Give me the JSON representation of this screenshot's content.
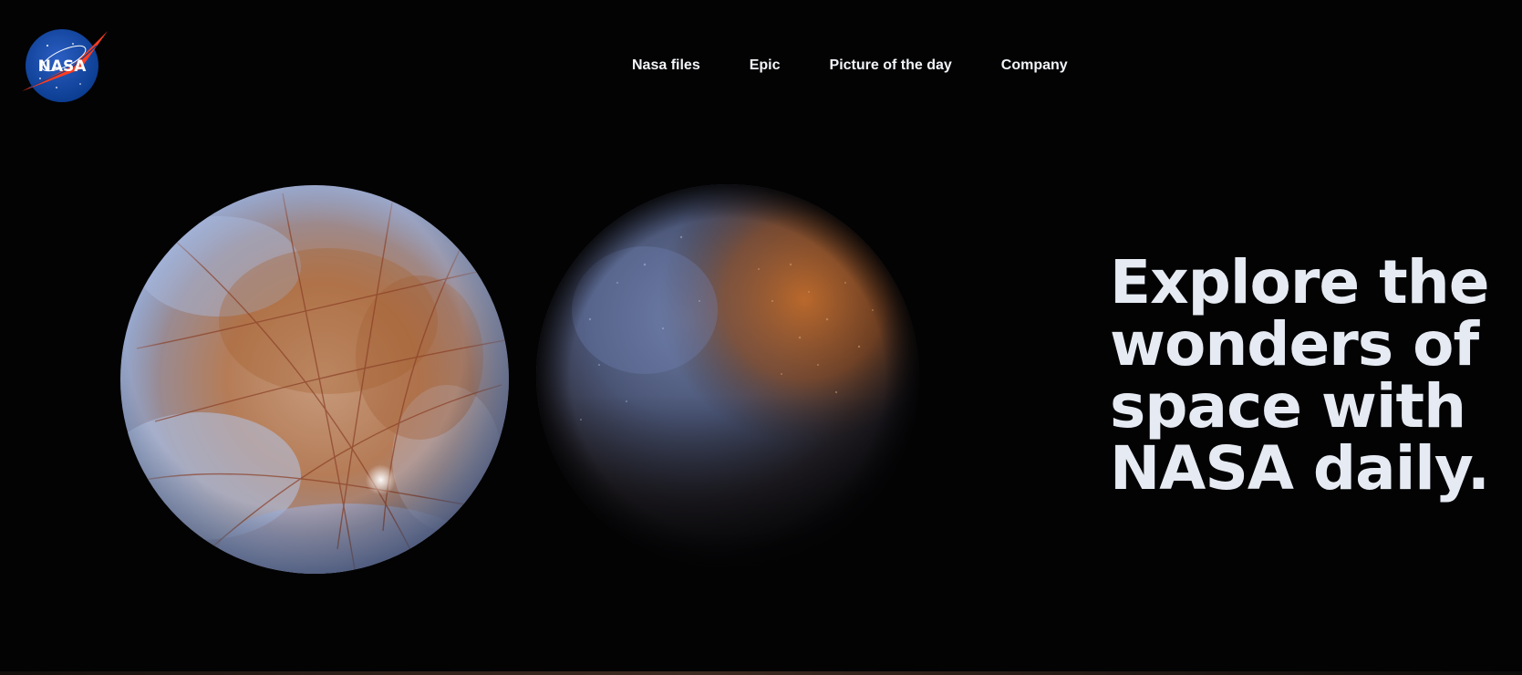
{
  "header": {
    "logo_text": "NASA",
    "logo_icon": "nasa-meatball-icon",
    "nav": [
      {
        "label": "Nasa files"
      },
      {
        "label": "Epic"
      },
      {
        "label": "Picture of the day"
      },
      {
        "label": "Company"
      }
    ]
  },
  "hero": {
    "headline_lines": [
      "Explore the",
      "wonders of",
      "space with",
      "NASA daily."
    ],
    "images": [
      {
        "name": "europa-moon-image"
      },
      {
        "name": "dark-moon-image"
      }
    ]
  },
  "colors": {
    "background": "#030304",
    "nav_text": "#f2f4f8",
    "headline_text": "#e6ebf3",
    "logo_blue": "#0b3d91",
    "logo_red": "#fc3d21"
  }
}
